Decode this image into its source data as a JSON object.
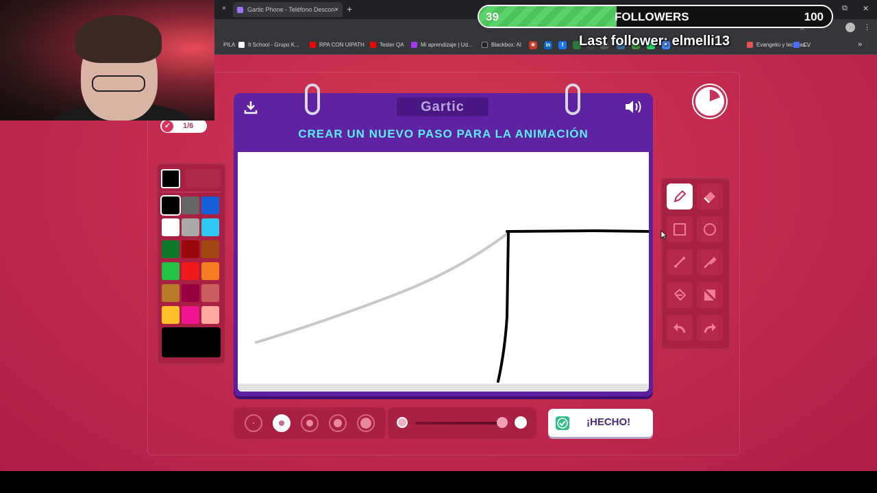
{
  "browser": {
    "active_tab_title": "Gartic Phone - Teléfono Descon",
    "tab_close": "×",
    "new_tab": "+",
    "window_controls": [
      "—",
      "⧉",
      "✕"
    ],
    "bookmarks": [
      {
        "label": "PILA",
        "color": "#3a3a3a"
      },
      {
        "label": "It School - Grupo K...",
        "color": "#ffffff"
      },
      {
        "label": "RPA CON UIPATH",
        "color": "#ff0000"
      },
      {
        "label": "Tester QA",
        "color": "#ff0000"
      },
      {
        "label": "Mi aprendizaje | Ud...",
        "color": "#a435f0"
      },
      {
        "label": "Blackbox: AI",
        "color": "#222222"
      },
      {
        "label": "Evangelio y lecturas...",
        "color": "#e85050"
      },
      {
        "label": "CV",
        "color": "#4a6cff"
      }
    ],
    "bookmarks_more": "»"
  },
  "stream_overlay": {
    "followers_current": "39",
    "followers_label": "FOLLOWERS",
    "followers_goal": "100",
    "followers_progress": 0.39,
    "last_follower": "Last follower: elmelli13"
  },
  "game": {
    "round": "1/6",
    "logo": "Gartic",
    "instruction": "CREAR UN NUEVO PASO PARA LA ANIMACIÓN",
    "done_label": "¡HECHO!",
    "current_color": "#000000",
    "palette": [
      "#000000",
      "#666666",
      "#1560d8",
      "#ffffff",
      "#aaaaaa",
      "#2ec8f5",
      "#117a2a",
      "#9b0a0a",
      "#a04a12",
      "#23c446",
      "#f01818",
      "#f57c20",
      "#b87a2a",
      "#990041",
      "#c95e5e",
      "#fec02a",
      "#f01590",
      "#fea8a0"
    ],
    "tools": [
      "pencil-icon",
      "eraser-icon",
      "rectangle-icon",
      "ellipse-icon",
      "line-icon",
      "eyedropper-icon",
      "fill-icon",
      "clear-icon",
      "undo-icon",
      "redo-icon"
    ],
    "active_tool": "pencil-icon",
    "brush_sizes_count": 5,
    "selected_brush_size": 2,
    "opacity": 1.0
  }
}
